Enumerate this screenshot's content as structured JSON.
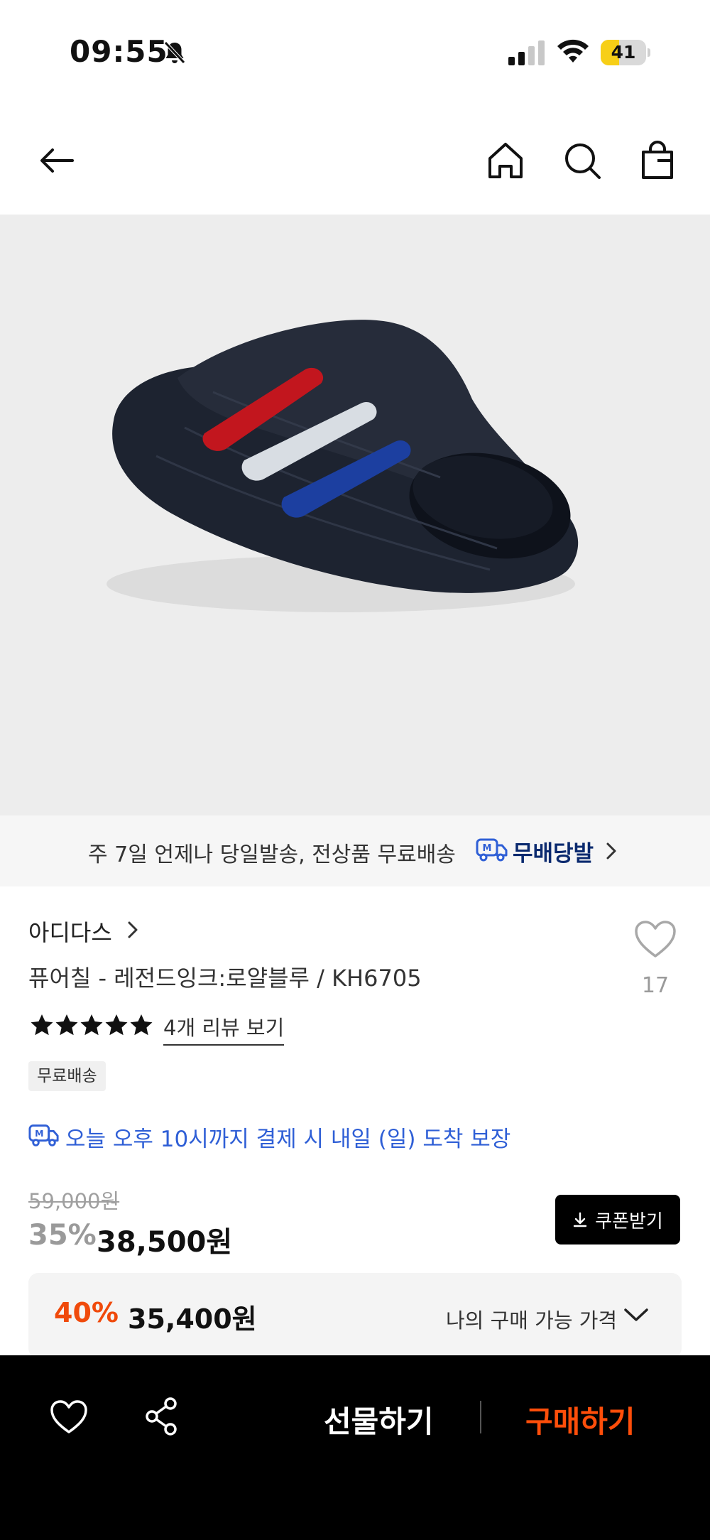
{
  "status_bar": {
    "time": "09:55",
    "battery_level": "41",
    "battery_fraction": 0.41,
    "icons": [
      "bell-slash-icon",
      "cellular-signal-icon",
      "wifi-icon",
      "battery-icon"
    ]
  },
  "nav": {
    "icons": [
      "back-arrow-icon",
      "home-icon",
      "search-icon",
      "shopping-bag-icon"
    ]
  },
  "banner": {
    "text": "주 7일 언제나 당일발송, 전상품 무료배송",
    "brand": "무배당발",
    "icon": "delivery-truck-icon"
  },
  "product": {
    "brand": "아디다스",
    "title": "퓨어칠 - 레전드잉크:로얄블루 / KH6705",
    "wish_count": "17",
    "rating": 5,
    "review_link": "4개 리뷰 보기",
    "badge": "무료배송",
    "delivery_note": "오늘 오후 10시까지 결제 시 내일 (일) 도착 보장",
    "original_price": "59,000원",
    "discount_rate": "35%",
    "sale_price": "38,500원",
    "coupon_label": "쿠폰받기"
  },
  "my_price": {
    "rate": "40%",
    "price": "35,400원",
    "label": "나의 구매 가능 가격"
  },
  "bottom_bar": {
    "gift_label": "선물하기",
    "buy_label": "구매하기",
    "icons": [
      "heart-icon",
      "share-icon"
    ]
  },
  "colors": {
    "accent_orange": "#ff4e0a",
    "discount_orange": "#f04a0b",
    "link_blue": "#2f5fd6",
    "brand_navy": "#0b2a6f",
    "battery_yellow": "#f7cf17"
  }
}
